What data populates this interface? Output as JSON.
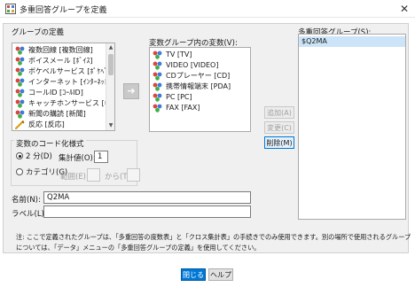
{
  "window": {
    "title": "多重回答グループを定義",
    "close_glyph": "✕"
  },
  "set_definition": {
    "label": "グループの定義",
    "variables": [
      {
        "label": "複数回線 [複数回線]",
        "icon": "nominal-var-icon"
      },
      {
        "label": "ボイスメール [ﾎﾞｲｽ]",
        "icon": "nominal-var-icon"
      },
      {
        "label": "ボケベルサービス [ﾎﾟｹﾍﾞﾙ]",
        "icon": "nominal-var-icon"
      },
      {
        "label": "インターネット [ｲﾝﾀｰﾈｯﾄ]",
        "icon": "nominal-var-icon"
      },
      {
        "label": "コールID [ｺｰﾙID]",
        "icon": "nominal-var-icon"
      },
      {
        "label": "キャッチホンサービス [ｷｬ...",
        "icon": "nominal-var-icon"
      },
      {
        "label": "新聞の購読 [新聞]",
        "icon": "nominal-var-icon"
      },
      {
        "label": "反応 [反応]",
        "icon": "scale-var-icon"
      }
    ]
  },
  "variables_in_set": {
    "label": "変数グループ内の変数(V):",
    "items": [
      {
        "label": "TV [TV]",
        "icon": "nominal-var-icon"
      },
      {
        "label": "VIDEO [VIDEO]",
        "icon": "nominal-var-icon"
      },
      {
        "label": "CDプレーヤー [CD]",
        "icon": "nominal-var-icon"
      },
      {
        "label": "携帯情報端末 [PDA]",
        "icon": "nominal-var-icon"
      },
      {
        "label": "PC [PC]",
        "icon": "nominal-var-icon"
      },
      {
        "label": "FAX [FAX]",
        "icon": "nominal-var-icon"
      }
    ],
    "move_glyph": "➔"
  },
  "coding": {
    "label": "変数のコード化様式",
    "dichotomies_label": "2 分(D)",
    "counted_value_label": "集計値(O):",
    "counted_value": "1",
    "categories_label": "カテゴリ(G)",
    "range_label": "範囲(E):",
    "through_label": "から(T)",
    "range_from": "",
    "range_to": ""
  },
  "name": {
    "label": "名前(N):",
    "value": "Q2MA"
  },
  "var_label": {
    "label": "ラベル(L):",
    "value": ""
  },
  "set_list": {
    "label": "多重回答グループ(S):",
    "items": [
      "$Q2MA"
    ]
  },
  "buttons": {
    "add": "追加(A)",
    "change": "変更(C)",
    "remove": "削除(M)",
    "close": "閉じる",
    "help": "ヘルプ"
  },
  "note": {
    "line1": "注: ここで定義されたグループは、「多重回答の度数表」と「クロス集計表」の手続きでのみ使用できます。別の場所で使用されるグループ",
    "line2": "については、「データ」メニューの「多重回答グループの定義」を使用してください。"
  },
  "colors": {
    "accent": "#0078d7",
    "selection": "#cce4f7",
    "panel": "#f0f0f0"
  }
}
